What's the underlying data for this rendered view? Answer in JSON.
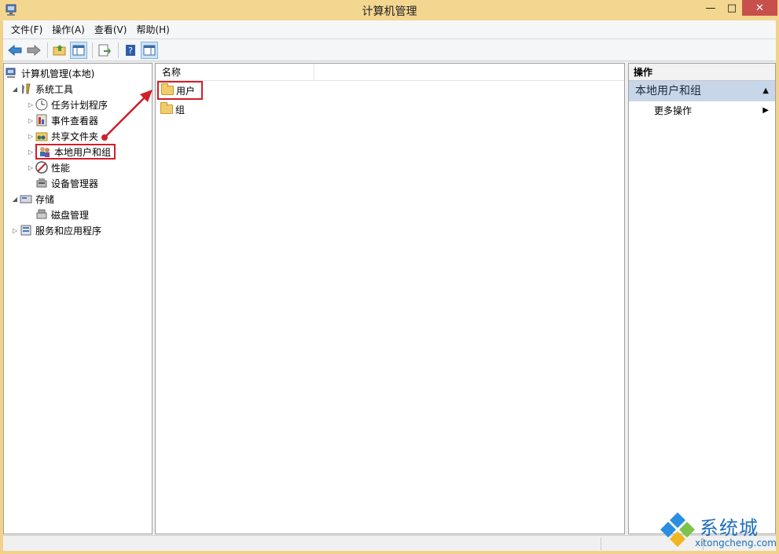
{
  "window": {
    "title": "计算机管理",
    "controls": {
      "minimize": "—",
      "maximize": "□",
      "close": "✕"
    }
  },
  "menu": [
    {
      "label": "文件(F)"
    },
    {
      "label": "操作(A)"
    },
    {
      "label": "查看(V)"
    },
    {
      "label": "帮助(H)"
    }
  ],
  "toolbar": {
    "icons": [
      "back-arrow-icon",
      "forward-arrow-icon",
      "up-folder-icon",
      "show-hide-console-tree-icon",
      "export-list-icon",
      "help-icon",
      "show-hide-action-pane-icon"
    ]
  },
  "tree": {
    "items": [
      {
        "label": "计算机管理(本地)",
        "toggle": "",
        "icon": "computer-management-icon"
      },
      {
        "label": "系统工具",
        "toggle": "◢",
        "icon": "system-tools-icon"
      },
      {
        "label": "任务计划程序",
        "toggle": "▷",
        "icon": "clock-icon"
      },
      {
        "label": "事件查看器",
        "toggle": "▷",
        "icon": "event-viewer-icon"
      },
      {
        "label": "共享文件夹",
        "toggle": "▷",
        "icon": "shared-folder-icon"
      },
      {
        "label": "本地用户和组",
        "toggle": "▷",
        "icon": "local-users-groups-icon"
      },
      {
        "label": "性能",
        "toggle": "▷",
        "icon": "performance-icon"
      },
      {
        "label": "设备管理器",
        "toggle": "",
        "icon": "device-manager-icon"
      },
      {
        "label": "存储",
        "toggle": "◢",
        "icon": "storage-icon"
      },
      {
        "label": "磁盘管理",
        "toggle": "",
        "icon": "disk-management-icon"
      },
      {
        "label": "服务和应用程序",
        "toggle": "▷",
        "icon": "services-apps-icon"
      }
    ]
  },
  "list": {
    "column_name": "名称",
    "rows": [
      {
        "label": "用户",
        "icon": "folder-icon"
      },
      {
        "label": "组",
        "icon": "folder-icon"
      }
    ]
  },
  "actions": {
    "title": "操作",
    "group": "本地用户和组",
    "group_caret": "▲",
    "item": "更多操作",
    "item_caret": "▶"
  },
  "watermark": {
    "cn": "系统城",
    "en": "xitongcheng.com"
  },
  "colors": {
    "title_bar": "#f3d690",
    "close_button": "#c7504d",
    "annotation_red": "#d0202a",
    "selection_blue": "#c7d7e9",
    "watermark_blue": "#1d6fbd"
  }
}
